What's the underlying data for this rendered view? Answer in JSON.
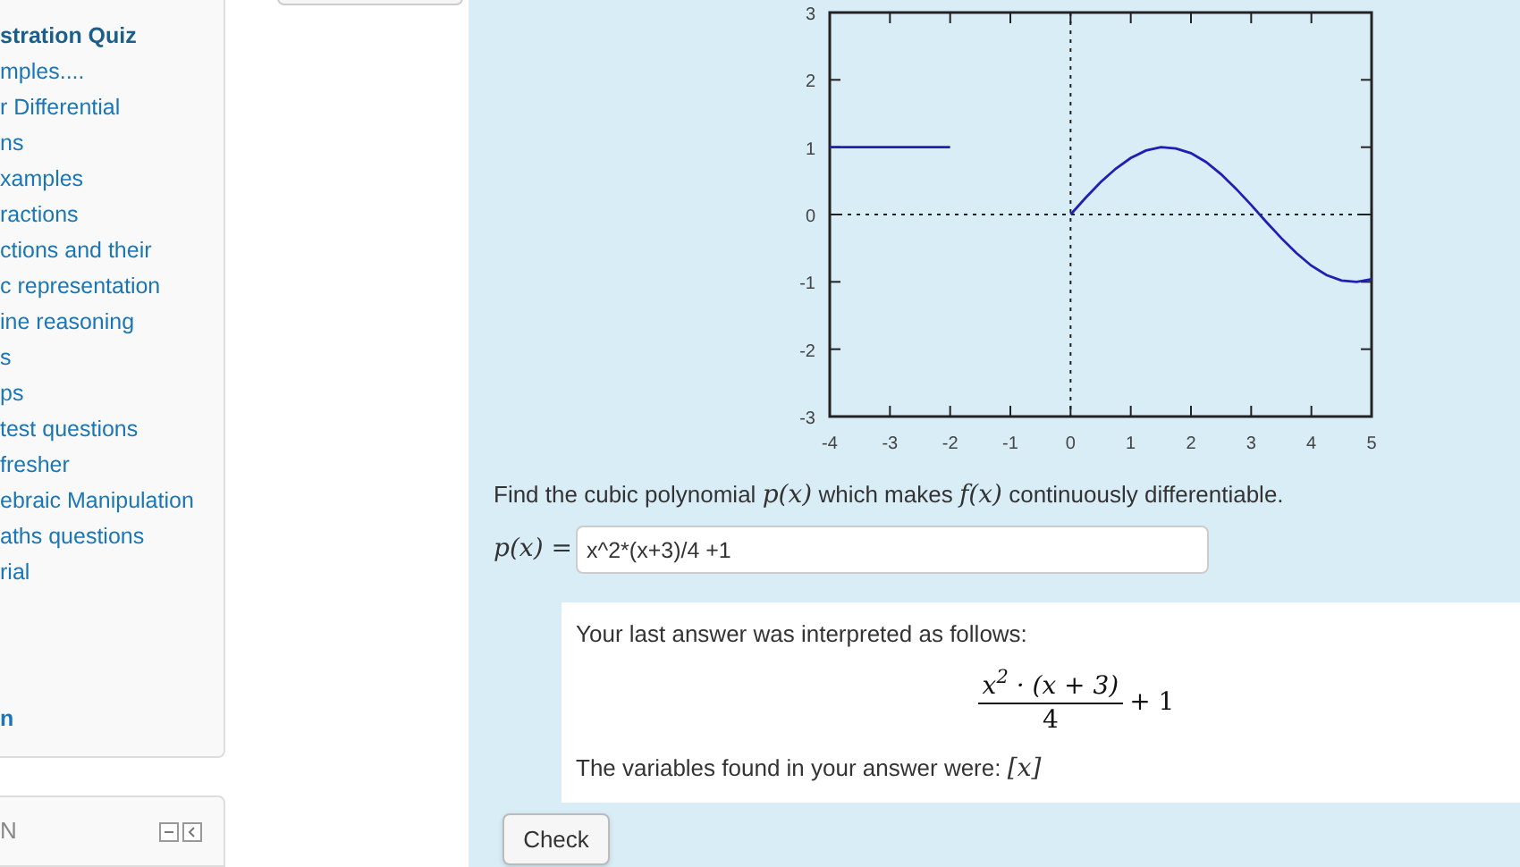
{
  "sidebar": {
    "items": [
      {
        "label": "stration Quiz",
        "selected": true
      },
      {
        "label": "mples....",
        "selected": false
      },
      {
        "label": "r Differential\nns",
        "selected": false
      },
      {
        "label": "xamples",
        "selected": false
      },
      {
        "label": "ractions",
        "selected": false
      },
      {
        "label": "ctions and their\nc representation",
        "selected": false
      },
      {
        "label": "ine reasoning\ns",
        "selected": false
      },
      {
        "label": "ps",
        "selected": false
      },
      {
        "label": "test questions",
        "selected": false
      },
      {
        "label": "fresher",
        "selected": false
      },
      {
        "label": "ebraic Manipulation",
        "selected": false
      },
      {
        "label": "aths questions",
        "selected": false
      },
      {
        "label": "rial",
        "selected": false
      }
    ],
    "footer_link": "n"
  },
  "second_block": {
    "title": "N"
  },
  "question": {
    "chart_data": {
      "type": "line",
      "x": [
        -4,
        -3,
        -2,
        0,
        0.25,
        0.5,
        0.75,
        1,
        1.25,
        1.5,
        1.75,
        2,
        2.25,
        2.5,
        2.75,
        3,
        3.25,
        3.5,
        3.75,
        4,
        4.25,
        4.5,
        4.75,
        5
      ],
      "series": [
        {
          "color": "#1f1fb4",
          "values": [
            1,
            1,
            1,
            null,
            null,
            null,
            null,
            null,
            null,
            null,
            null,
            null,
            null,
            null,
            null,
            null,
            null,
            null,
            null,
            null,
            null,
            null,
            null,
            null
          ]
        },
        {
          "color": "#1f1fb4",
          "values": [
            null,
            null,
            null,
            0,
            0.25,
            0.48,
            0.68,
            0.84,
            0.95,
            1,
            0.98,
            0.91,
            0.78,
            0.6,
            0.38,
            0.14,
            -0.11,
            -0.35,
            -0.57,
            -0.76,
            -0.9,
            -0.98,
            -1,
            -0.96
          ]
        }
      ],
      "xlim": [
        -4,
        5
      ],
      "ylim": [
        -3,
        3
      ],
      "xticks": [
        -4,
        -3,
        -2,
        -1,
        0,
        1,
        2,
        3,
        4,
        5
      ],
      "yticks": [
        -3,
        -2,
        -1,
        0,
        1,
        2,
        3
      ]
    },
    "prompt": [
      {
        "kind": "text",
        "text": "Find the cubic polynomial "
      },
      {
        "kind": "math",
        "text": "p(x)"
      },
      {
        "kind": "text",
        "text": " which makes "
      },
      {
        "kind": "math",
        "text": "f(x)"
      },
      {
        "kind": "text",
        "text": " continuously differentiable."
      }
    ],
    "answer_label": "p(x) =",
    "answer_value": "x^2*(x+3)/4 +1",
    "feedback": {
      "intro": "Your last answer was interpreted as follows:",
      "numerator": "x$^{2}$ · (x + 3)",
      "denominator": "4",
      "suffix": "+ 1",
      "variables_text": "The variables found in your answer were:",
      "variables": "[x]"
    },
    "check_button": "Check"
  }
}
